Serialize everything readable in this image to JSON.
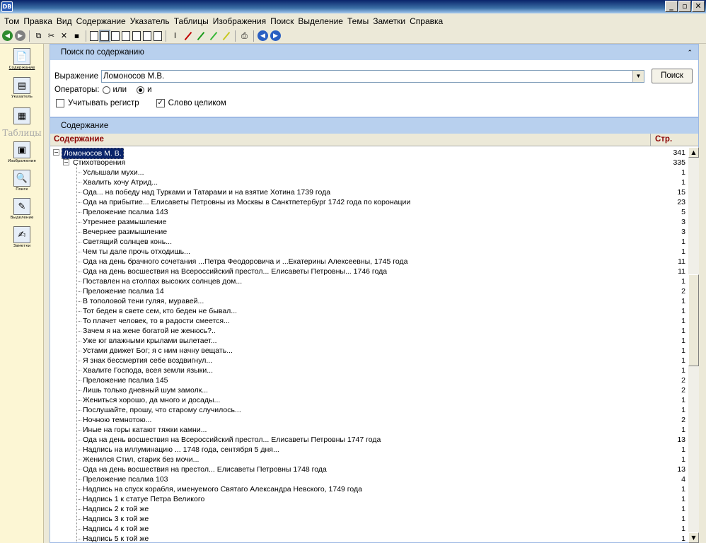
{
  "window": {
    "app_icon": "DB",
    "min": "_",
    "restore": "▫",
    "close": "✕"
  },
  "menu": [
    "Том",
    "Правка",
    "Вид",
    "Содержание",
    "Указатель",
    "Таблицы",
    "Изображения",
    "Поиск",
    "Выделение",
    "Темы",
    "Заметки",
    "Справка"
  ],
  "sidebar": {
    "items": [
      {
        "label": "Содержание",
        "icon": "contents-icon"
      },
      {
        "label": "Указатель",
        "icon": "index-icon"
      },
      {
        "label": "Изображения",
        "icon": "images-icon"
      },
      {
        "label": "Поиск",
        "icon": "search-icon"
      },
      {
        "label": "Выделение",
        "icon": "highlight-icon"
      },
      {
        "label": "Заметки",
        "icon": "notes-icon"
      }
    ],
    "tables_label": "Таблицы"
  },
  "search": {
    "panel_title": "Поиск по содержанию",
    "expression_label": "Выражение",
    "expression_value": "Ломоносов М.В.",
    "search_button": "Поиск",
    "operators_label": "Операторы:",
    "op_or": "или",
    "op_and": "и",
    "case_label": "Учитывать регистр",
    "whole_word_label": "Слово целиком"
  },
  "contents": {
    "panel_title": "Содержание",
    "col_title": "Содержание",
    "col_page": "Стр.",
    "root": {
      "title": "Ломоносов М. В.",
      "page": "341"
    },
    "group": {
      "title": "Стихотворения",
      "page": "335"
    },
    "items": [
      {
        "title": "Услышали мухи...",
        "page": "1"
      },
      {
        "title": "Хвалить хочу Атрид...",
        "page": "1"
      },
      {
        "title": "Ода... на победу над Турками и Татарами и на взятие Хотина 1739 года",
        "page": "15"
      },
      {
        "title": "Ода на прибытие... Елисаветы Петровны из Москвы в Санктпетербург 1742 года по коронации",
        "page": "23"
      },
      {
        "title": "Преложение псалма 143",
        "page": "5"
      },
      {
        "title": "Утреннее размышление",
        "page": "3"
      },
      {
        "title": "Вечернее размышление",
        "page": "3"
      },
      {
        "title": "Светящий солнцев конь...",
        "page": "1"
      },
      {
        "title": "Чем ты дале прочь отходишь...",
        "page": "1"
      },
      {
        "title": "Ода на день брачного сочетания ...Петра Феодоровича и ...Екатерины Алексеевны, 1745 года",
        "page": "11"
      },
      {
        "title": "Ода на день восшествия на Всероссийский престол... Елисаветы Петровны... 1746 года",
        "page": "11"
      },
      {
        "title": "Поставлен на столпах высоких солнцев дом...",
        "page": "1"
      },
      {
        "title": "Преложение псалма 14",
        "page": "2"
      },
      {
        "title": "В тополовой тени гуляя, муравей...",
        "page": "1"
      },
      {
        "title": "Тот беден в свете сем, кто беден не бывал...",
        "page": "1"
      },
      {
        "title": "То плачет человек, то в радости смеется...",
        "page": "1"
      },
      {
        "title": "Зачем я на жене богатой не женюсь?..",
        "page": "1"
      },
      {
        "title": "Уже юг влажными крылами вылетает...",
        "page": "1"
      },
      {
        "title": "Устами движет Бог; я с ним начну вещать...",
        "page": "1"
      },
      {
        "title": "Я знак бессмертия себе воздвигнул...",
        "page": "1"
      },
      {
        "title": "Хвалите Господа, всея земли языки...",
        "page": "1"
      },
      {
        "title": "Преложение псалма 145",
        "page": "2"
      },
      {
        "title": "Лишь только дневный шум замолк...",
        "page": "2"
      },
      {
        "title": "Жениться хорошо, да много и досады...",
        "page": "1"
      },
      {
        "title": "Послушайте, прошу, что старому случилось...",
        "page": "1"
      },
      {
        "title": "Ночною темнотою...",
        "page": "2"
      },
      {
        "title": "Иные на горы катают тяжки камни...",
        "page": "1"
      },
      {
        "title": "Ода на день восшествия на Всероссийский престол... Елисаветы Петровны 1747 года",
        "page": "13"
      },
      {
        "title": "Надпись на иллуминацию ... 1748 года, сентября 5 дня...",
        "page": "1"
      },
      {
        "title": "Женился Стил, старик без мочи...",
        "page": "1"
      },
      {
        "title": "Ода на день восшествия на престол... Елисаветы Петровны 1748 года",
        "page": "13"
      },
      {
        "title": "Преложение псалма 103",
        "page": "4"
      },
      {
        "title": "Надпись на спуск корабля, именуемого Святаго Александра Невского, 1749 года",
        "page": "1"
      },
      {
        "title": "Надпись 1 к статуе Петра Великого",
        "page": "1"
      },
      {
        "title": "Надпись 2 к той же",
        "page": "1"
      },
      {
        "title": "Надпись 3 к той же",
        "page": "1"
      },
      {
        "title": "Надпись 4 к той же",
        "page": "1"
      },
      {
        "title": "Надпись 5 к той же",
        "page": "1"
      }
    ]
  }
}
